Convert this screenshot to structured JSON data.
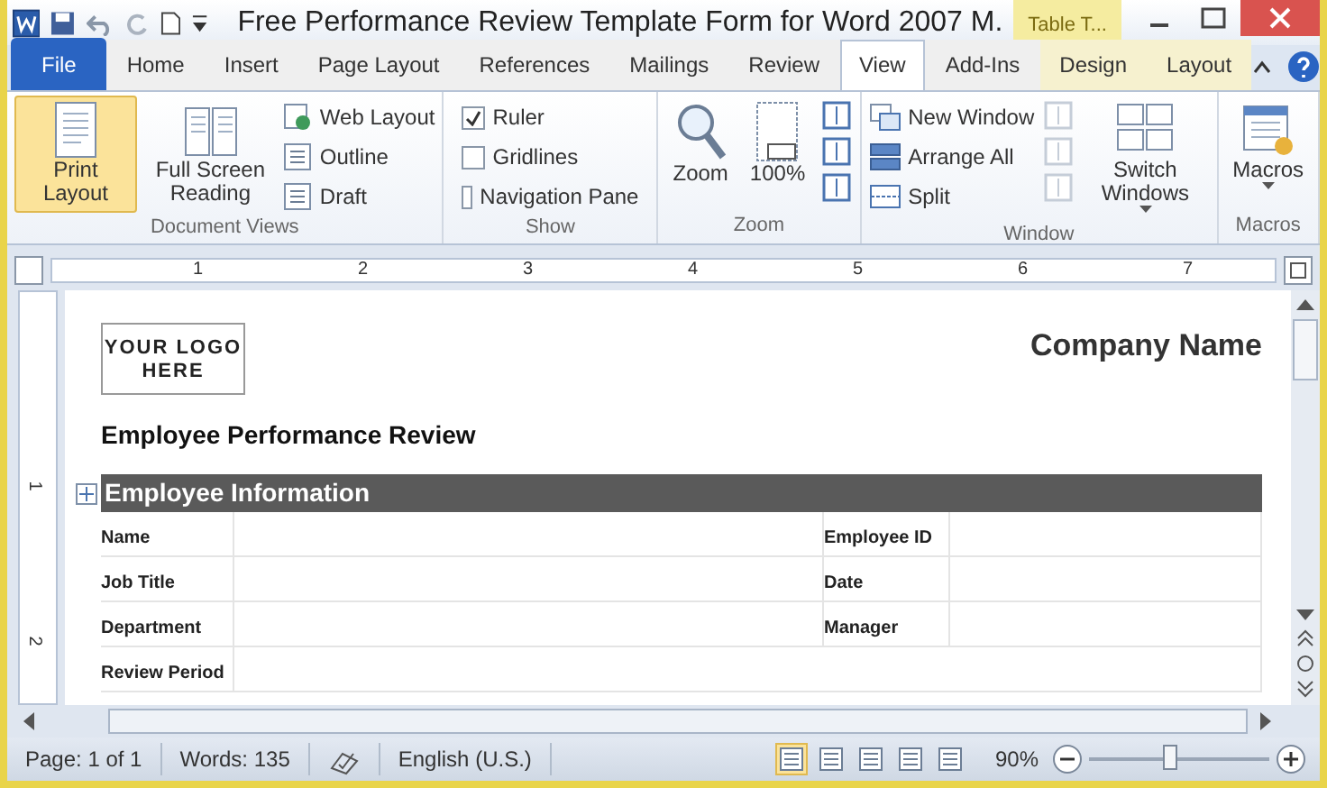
{
  "title_bar": {
    "title": "Free Performance Review Template Form for Word 2007 M.",
    "contextual_tab": "Table T..."
  },
  "tabs": [
    {
      "label": "File",
      "kind": "file",
      "selected": false
    },
    {
      "label": "Home",
      "kind": "normal",
      "selected": false
    },
    {
      "label": "Insert",
      "kind": "normal",
      "selected": false
    },
    {
      "label": "Page Layout",
      "kind": "normal",
      "selected": false
    },
    {
      "label": "References",
      "kind": "normal",
      "selected": false
    },
    {
      "label": "Mailings",
      "kind": "normal",
      "selected": false
    },
    {
      "label": "Review",
      "kind": "normal",
      "selected": false
    },
    {
      "label": "View",
      "kind": "normal",
      "selected": true
    },
    {
      "label": "Add-Ins",
      "kind": "normal",
      "selected": false
    },
    {
      "label": "Design",
      "kind": "contextual",
      "selected": false
    },
    {
      "label": "Layout",
      "kind": "contextual",
      "selected": false
    }
  ],
  "ribbon": [
    {
      "label": "Document Views",
      "items": [
        {
          "kind": "large",
          "label": "Print Layout",
          "selected": true
        },
        {
          "kind": "large",
          "label": "Full Screen Reading",
          "selected": false
        },
        {
          "kind": "stack",
          "items": [
            {
              "label": "Web Layout"
            },
            {
              "label": "Outline"
            },
            {
              "label": "Draft"
            }
          ]
        }
      ]
    },
    {
      "label": "Show",
      "items": [
        {
          "kind": "checks",
          "items": [
            {
              "label": "Ruler",
              "checked": true
            },
            {
              "label": "Gridlines",
              "checked": false
            },
            {
              "label": "Navigation Pane",
              "checked": false
            }
          ]
        }
      ]
    },
    {
      "label": "Zoom",
      "items": [
        {
          "kind": "large",
          "label": "Zoom",
          "selected": false
        },
        {
          "kind": "large",
          "label": "100%",
          "selected": false
        },
        {
          "kind": "iconstack",
          "disabled": false
        }
      ]
    },
    {
      "label": "Window",
      "items": [
        {
          "kind": "stack",
          "items": [
            {
              "label": "New Window"
            },
            {
              "label": "Arrange All"
            },
            {
              "label": "Split"
            }
          ]
        },
        {
          "kind": "iconstack",
          "disabled": true
        },
        {
          "kind": "large",
          "label": "Switch Windows",
          "selected": false,
          "dropdown": true
        }
      ]
    },
    {
      "label": "Macros",
      "items": [
        {
          "kind": "large",
          "label": "Macros",
          "selected": false,
          "dropdown": true
        }
      ]
    }
  ],
  "ruler": {
    "numbers": [
      "1",
      "2",
      "3",
      "4",
      "5",
      "6",
      "7"
    ]
  },
  "vertical_ruler": {
    "numbers": [
      "1",
      "2"
    ]
  },
  "document": {
    "logo": "YOUR LOGO HERE",
    "company": "Company Name",
    "heading": "Employee Performance Review",
    "section": "Employee Information",
    "rows": [
      [
        "Name",
        "Employee ID"
      ],
      [
        "Job Title",
        "Date"
      ],
      [
        "Department",
        "Manager"
      ],
      [
        "Review Period"
      ]
    ]
  },
  "status_bar": {
    "page": "Page: 1 of 1",
    "words": "Words: 135",
    "language": "English (U.S.)",
    "views": [
      {
        "selected": true
      },
      {
        "selected": false
      },
      {
        "selected": false
      },
      {
        "selected": false
      },
      {
        "selected": false
      }
    ],
    "zoom": "90%",
    "zoom_level": {
      "level": 0.45
    }
  }
}
